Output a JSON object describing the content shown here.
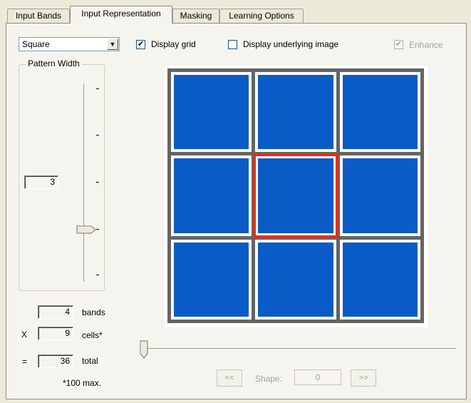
{
  "tabs": [
    {
      "label": "Input Bands"
    },
    {
      "label": "Input Representation",
      "active": true
    },
    {
      "label": "Masking"
    },
    {
      "label": "Learning Options"
    }
  ],
  "pattern_shape": {
    "selected": "Square"
  },
  "options": {
    "display_grid": {
      "label": "Display grid",
      "checked": true
    },
    "display_underlying_image": {
      "label": "Display underlying image",
      "checked": false
    },
    "enhance": {
      "label": "Enhance",
      "checked": true,
      "enabled": false
    }
  },
  "pattern_width": {
    "title": "Pattern Width",
    "value": "3",
    "slider_position": "3 of 4 tick intervals from top"
  },
  "calculation": {
    "bands_value": "4",
    "bands_label": "bands",
    "times_sign": "X",
    "cells_value": "9",
    "cells_label": "cells*",
    "equals_sign": "=",
    "total_value": "36",
    "total_label": "total",
    "footnote": "*100 max."
  },
  "grid": {
    "rows": 3,
    "cols": 3,
    "cell_color": "#0a5bc5",
    "line_color": "#646464",
    "highlight_color": "#f02a10",
    "highlighted_cell": {
      "row": 1,
      "col": 1
    }
  },
  "shape_nav": {
    "prev_label": "<<",
    "shape_label": "Shape:",
    "shape_value": "0",
    "next_label": ">>"
  },
  "icons": {
    "dropdown": "chevron-down-icon",
    "check": "checkmark-icon"
  }
}
